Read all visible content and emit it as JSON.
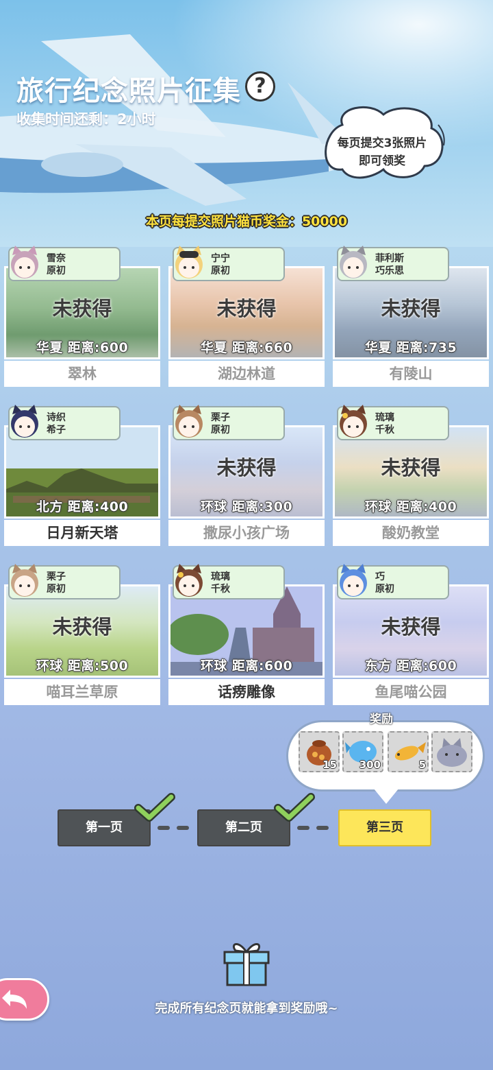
{
  "header": {
    "title": "旅行纪念照片征集",
    "help_icon": "question-icon",
    "timer": "收集时间还剩：2小时",
    "bubble_line1": "每页提交3张照片",
    "bubble_line2": "即可领奖",
    "bonus": "本页每提交照片猫币奖金：50000"
  },
  "cards": [
    {
      "cat1": "雪奈",
      "cat2": "原初",
      "status": "未获得",
      "distance": "华夏  距离:600",
      "place": "翠林",
      "obtained": false
    },
    {
      "cat1": "宁宁",
      "cat2": "原初",
      "status": "未获得",
      "distance": "华夏  距离:660",
      "place": "湖边林道",
      "obtained": false
    },
    {
      "cat1": "菲利斯",
      "cat2": "巧乐思",
      "status": "未获得",
      "distance": "华夏  距离:735",
      "place": "有陵山",
      "obtained": false
    },
    {
      "cat1": "诗织",
      "cat2": "希子",
      "status": "",
      "distance": "北方  距离:400",
      "place": "日月新天塔",
      "obtained": true
    },
    {
      "cat1": "栗子",
      "cat2": "原初",
      "status": "未获得",
      "distance": "环球  距离:300",
      "place": "撒尿小孩广场",
      "obtained": false
    },
    {
      "cat1": "琉璃",
      "cat2": "千秋",
      "status": "未获得",
      "distance": "环球  距离:400",
      "place": "酸奶教堂",
      "obtained": false
    },
    {
      "cat1": "栗子",
      "cat2": "原初",
      "status": "未获得",
      "distance": "环球  距离:500",
      "place": "喵耳兰草原",
      "obtained": false
    },
    {
      "cat1": "琉璃",
      "cat2": "千秋",
      "status": "",
      "distance": "环球  距离:600",
      "place": "话痨雕像",
      "obtained": true
    },
    {
      "cat1": "巧",
      "cat2": "原初",
      "status": "未获得",
      "distance": "东方  距离:600",
      "place": "鱼尾喵公园",
      "obtained": false
    }
  ],
  "rewards": {
    "label": "奖励",
    "items": [
      {
        "icon": "treasure-bag-icon",
        "count": "15"
      },
      {
        "icon": "blue-fish-icon",
        "count": "300"
      },
      {
        "icon": "golden-fish-icon",
        "count": "5"
      },
      {
        "icon": "gray-cat-icon",
        "count": ""
      }
    ]
  },
  "pages": [
    {
      "label": "第一页",
      "done": true
    },
    {
      "label": "第二页",
      "done": true
    },
    {
      "label": "第三页",
      "done": false
    }
  ],
  "footer": "完成所有纪念页就能拿到奖励哦~",
  "colors": {
    "bonus": "#ffe23d",
    "current_page": "#fde65a",
    "done_page": "#4f5356",
    "tag_bg": "#e6f8e2",
    "back_button": "#f07c9c"
  }
}
